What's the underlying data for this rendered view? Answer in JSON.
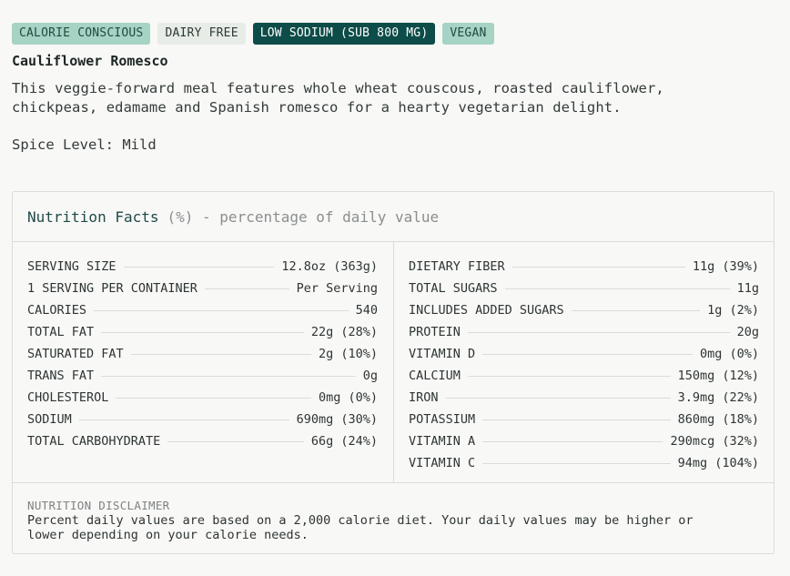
{
  "tags": [
    {
      "label": "CALORIE CONSCIOUS",
      "style": "soft"
    },
    {
      "label": "DAIRY FREE",
      "style": "pale"
    },
    {
      "label": "LOW SODIUM (SUB 800 MG)",
      "style": "dark"
    },
    {
      "label": "VEGAN",
      "style": "soft"
    }
  ],
  "meal": {
    "title": "Cauliflower Romesco",
    "description": "This veggie-forward meal features whole wheat couscous, roasted cauliflower, chickpeas, edamame and Spanish romesco for a hearty vegetarian delight.",
    "spice_label": "Spice Level:",
    "spice_value": "Mild"
  },
  "nutrition": {
    "heading": "Nutrition Facts",
    "subheading": "(%) - percentage of daily value",
    "left": [
      {
        "label": "SERVING SIZE",
        "value": "12.8oz (363g)"
      },
      {
        "label": "1 SERVING PER CONTAINER",
        "value": "Per Serving"
      },
      {
        "label": "CALORIES",
        "value": "540"
      },
      {
        "label": "TOTAL FAT",
        "value": "22g (28%)"
      },
      {
        "label": "SATURATED FAT",
        "value": "2g (10%)"
      },
      {
        "label": "TRANS FAT",
        "value": "0g"
      },
      {
        "label": "CHOLESTEROL",
        "value": "0mg (0%)"
      },
      {
        "label": "SODIUM",
        "value": "690mg (30%)"
      },
      {
        "label": "TOTAL CARBOHYDRATE",
        "value": "66g (24%)"
      }
    ],
    "right": [
      {
        "label": "DIETARY FIBER",
        "value": "11g (39%)"
      },
      {
        "label": "TOTAL SUGARS",
        "value": "11g"
      },
      {
        "label": "INCLUDES ADDED SUGARS",
        "value": "1g (2%)"
      },
      {
        "label": "PROTEIN",
        "value": "20g"
      },
      {
        "label": "VITAMIN D",
        "value": "0mg (0%)"
      },
      {
        "label": "CALCIUM",
        "value": "150mg (12%)"
      },
      {
        "label": "IRON",
        "value": "3.9mg (22%)"
      },
      {
        "label": "POTASSIUM",
        "value": "860mg (18%)"
      },
      {
        "label": "VITAMIN A",
        "value": "290mcg (32%)"
      },
      {
        "label": "VITAMIN C",
        "value": "94mg (104%)"
      }
    ],
    "disclaimer_title": "NUTRITION DISCLAIMER",
    "disclaimer_text": "Percent daily values are based on a 2,000 calorie diet. Your daily values may be higher or lower depending on your calorie needs."
  },
  "colors": {
    "tag_soft": "#a5d3c4",
    "tag_pale": "#e7ece7",
    "tag_dark": "#0d4c48",
    "heading": "#1f4a47"
  }
}
